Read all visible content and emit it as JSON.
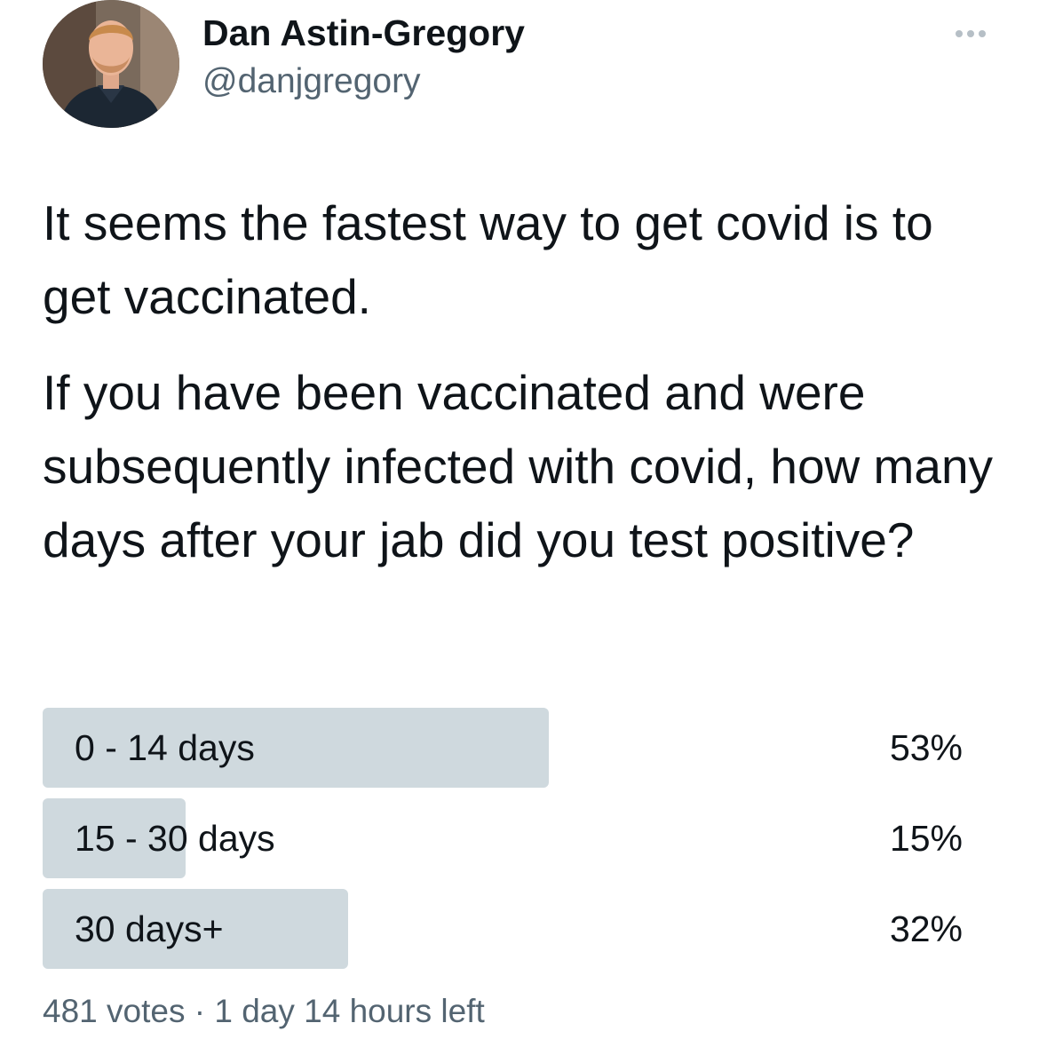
{
  "author": {
    "display_name": "Dan Astin-Gregory",
    "handle": "@danjgregory"
  },
  "tweet": {
    "paragraphs": [
      "It seems the fastest way to get covid is to get vaccinated.",
      "If you have been vaccinated and were subsequently infected with covid, how many days after your jab did you test positive?"
    ]
  },
  "poll": {
    "options": [
      {
        "label": "0 - 14 days",
        "percent_text": "53%",
        "percent": 53
      },
      {
        "label": "15 - 30 days",
        "percent_text": "15%",
        "percent": 15
      },
      {
        "label": "30 days+",
        "percent_text": "32%",
        "percent": 32
      }
    ],
    "footer": {
      "votes": "481 votes",
      "separator": "·",
      "time_left": "1 day 14 hours left"
    },
    "bar_color": "#cfd9de"
  },
  "icons": {
    "more": "more-horizontal-icon"
  },
  "colors": {
    "text_primary": "#0f1419",
    "text_secondary": "#536471"
  }
}
